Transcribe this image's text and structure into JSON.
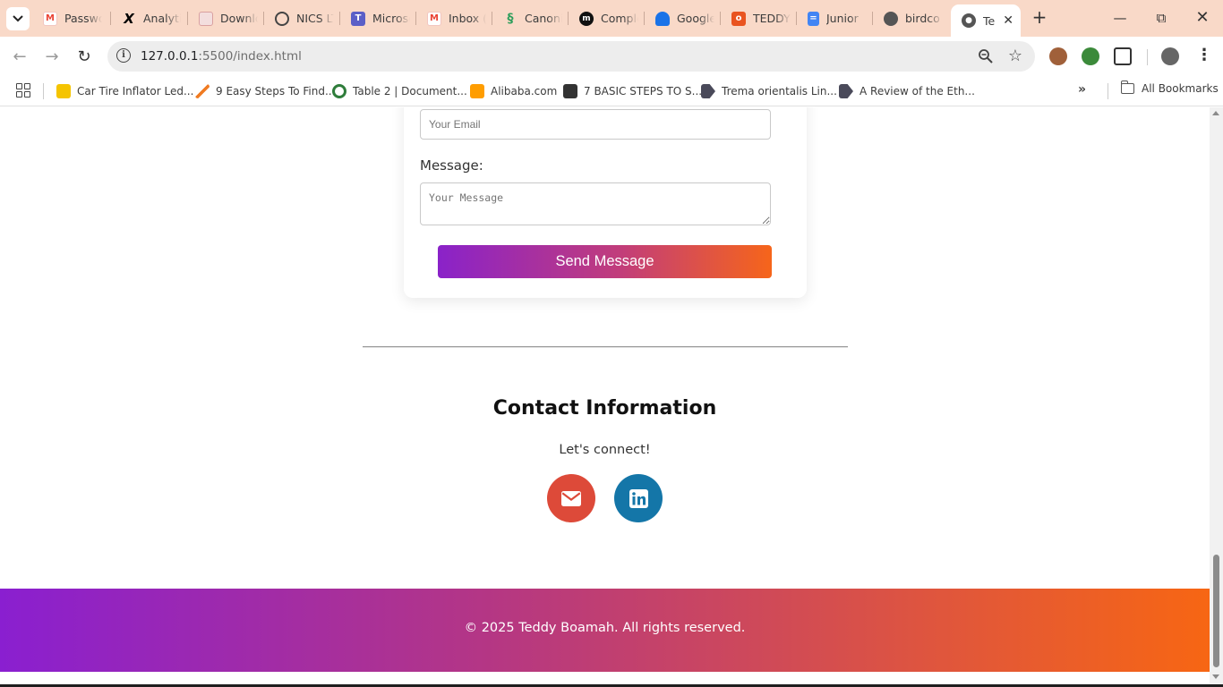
{
  "tabs": [
    {
      "label": "Passwo",
      "icon": "gmail-icon",
      "color": "#ea4335"
    },
    {
      "label": "Analytic",
      "icon": "x-icon",
      "color": "#000000"
    },
    {
      "label": "Downlo",
      "icon": "download-icon",
      "color": "#d9a0a0"
    },
    {
      "label": "NICS LT",
      "icon": "nics-icon",
      "color": "#444444"
    },
    {
      "label": "Microso",
      "icon": "teams-icon",
      "color": "#5b5fc7"
    },
    {
      "label": "Inbox (",
      "icon": "gmail-icon",
      "color": "#ea4335"
    },
    {
      "label": "Canoni",
      "icon": "canonical-icon",
      "color": "#2e9e5b"
    },
    {
      "label": "Comple",
      "icon": "m-icon",
      "color": "#111111"
    },
    {
      "label": "Google",
      "icon": "contacts-icon",
      "color": "#1a73e8"
    },
    {
      "label": "TEDDY",
      "icon": "ubuntu-icon",
      "color": "#e95420"
    },
    {
      "label": "Junior",
      "icon": "docs-icon",
      "color": "#4285f4"
    },
    {
      "label": "birdco",
      "icon": "github-icon",
      "color": "#555555"
    }
  ],
  "active_tab": {
    "label": "Te",
    "icon": "globe-icon"
  },
  "address": {
    "host": "127.0.0.1",
    "rest": ":5500/index.html"
  },
  "bookmarks": [
    {
      "label": "Car Tire Inflator Led...",
      "color": "#f5c400"
    },
    {
      "label": "9 Easy Steps To Find...",
      "color": "#f07b22"
    },
    {
      "label": "Table 2 | Document...",
      "color": "#2f7d3b"
    },
    {
      "label": "Alibaba.com",
      "color": "#ff9d00"
    },
    {
      "label": "7 BASIC STEPS TO S...",
      "color": "#333333"
    },
    {
      "label": "Trema orientalis Lin...",
      "color": "#4a4a5a"
    },
    {
      "label": "A Review of the Eth...",
      "color": "#4a4a5a"
    }
  ],
  "all_bookmarks": "All Bookmarks",
  "form": {
    "email_placeholder": "Your Email",
    "message_label": "Message:",
    "message_placeholder": "Your Message",
    "send_label": "Send Message"
  },
  "contact": {
    "title": "Contact Information",
    "subtitle": "Let's connect!",
    "socials": [
      {
        "name": "email",
        "icon": "envelope-icon",
        "color": "#dd4a39"
      },
      {
        "name": "linkedin",
        "icon": "linkedin-icon",
        "color": "#1476a8"
      }
    ]
  },
  "footer": {
    "text": "© 2025 Teddy Boamah. All rights reserved.",
    "gradient_start": "#8a1fd0",
    "gradient_end": "#f76613"
  },
  "colors": {
    "button_gradient_start": "#8a22c9",
    "button_gradient_end": "#f6651a",
    "tabbar_bg": "#f9d9c8"
  }
}
